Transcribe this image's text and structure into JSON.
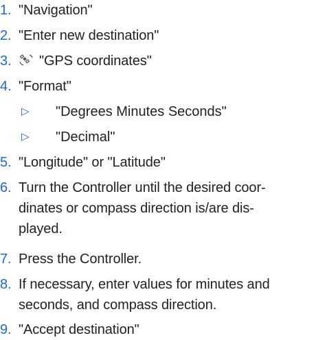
{
  "steps": [
    {
      "num": "1.",
      "text": "\"Navigation\""
    },
    {
      "num": "2.",
      "text": "\"Enter new destination\""
    },
    {
      "num": "3.",
      "icon": "gps-satellite-icon",
      "text": "\"GPS coordinates\""
    },
    {
      "num": "4.",
      "text": "\"Format\""
    },
    {
      "num": "5.",
      "text": "\"Longitude\" or \"Latitude\""
    },
    {
      "num": "6.",
      "lines": [
        "Turn the Controller until the desired coor-",
        "dinates or compass direction is/are dis-",
        "played."
      ]
    },
    {
      "num": "7.",
      "text": "Press the Controller."
    },
    {
      "num": "8.",
      "lines": [
        "If necessary, enter values for minutes and",
        "seconds, and compass direction."
      ]
    },
    {
      "num": "9.",
      "text": "\"Accept destination\""
    }
  ],
  "format_options": [
    {
      "marker": "▷",
      "text": "\"Degrees Minutes Seconds\""
    },
    {
      "marker": "▷",
      "text": "\"Decimal\""
    }
  ],
  "colors": {
    "accent": "#1c69d3",
    "text": "#222222"
  }
}
